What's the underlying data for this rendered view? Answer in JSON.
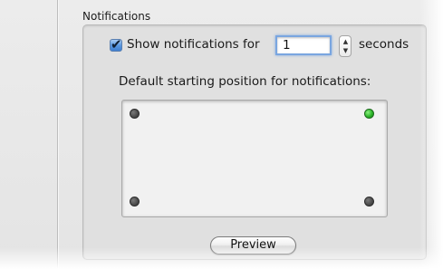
{
  "notifications": {
    "section_title": "Notifications",
    "show_checkbox": {
      "label": "Show notifications for",
      "checked": true,
      "check_glyph": "✔"
    },
    "duration": {
      "value": "1",
      "unit_label": "seconds"
    },
    "stepper": {
      "up_glyph": "▲",
      "down_glyph": "▼"
    },
    "position": {
      "heading": "Default starting position for notifications:",
      "options": [
        "top-left",
        "top-right",
        "bottom-left",
        "bottom-right"
      ],
      "selected": "top-right"
    },
    "preview_label": "Preview"
  },
  "colors": {
    "selected_dot": "#2db52a",
    "unselected_dot": "#4a4a4a",
    "focus_ring": "#7aa6e0"
  }
}
